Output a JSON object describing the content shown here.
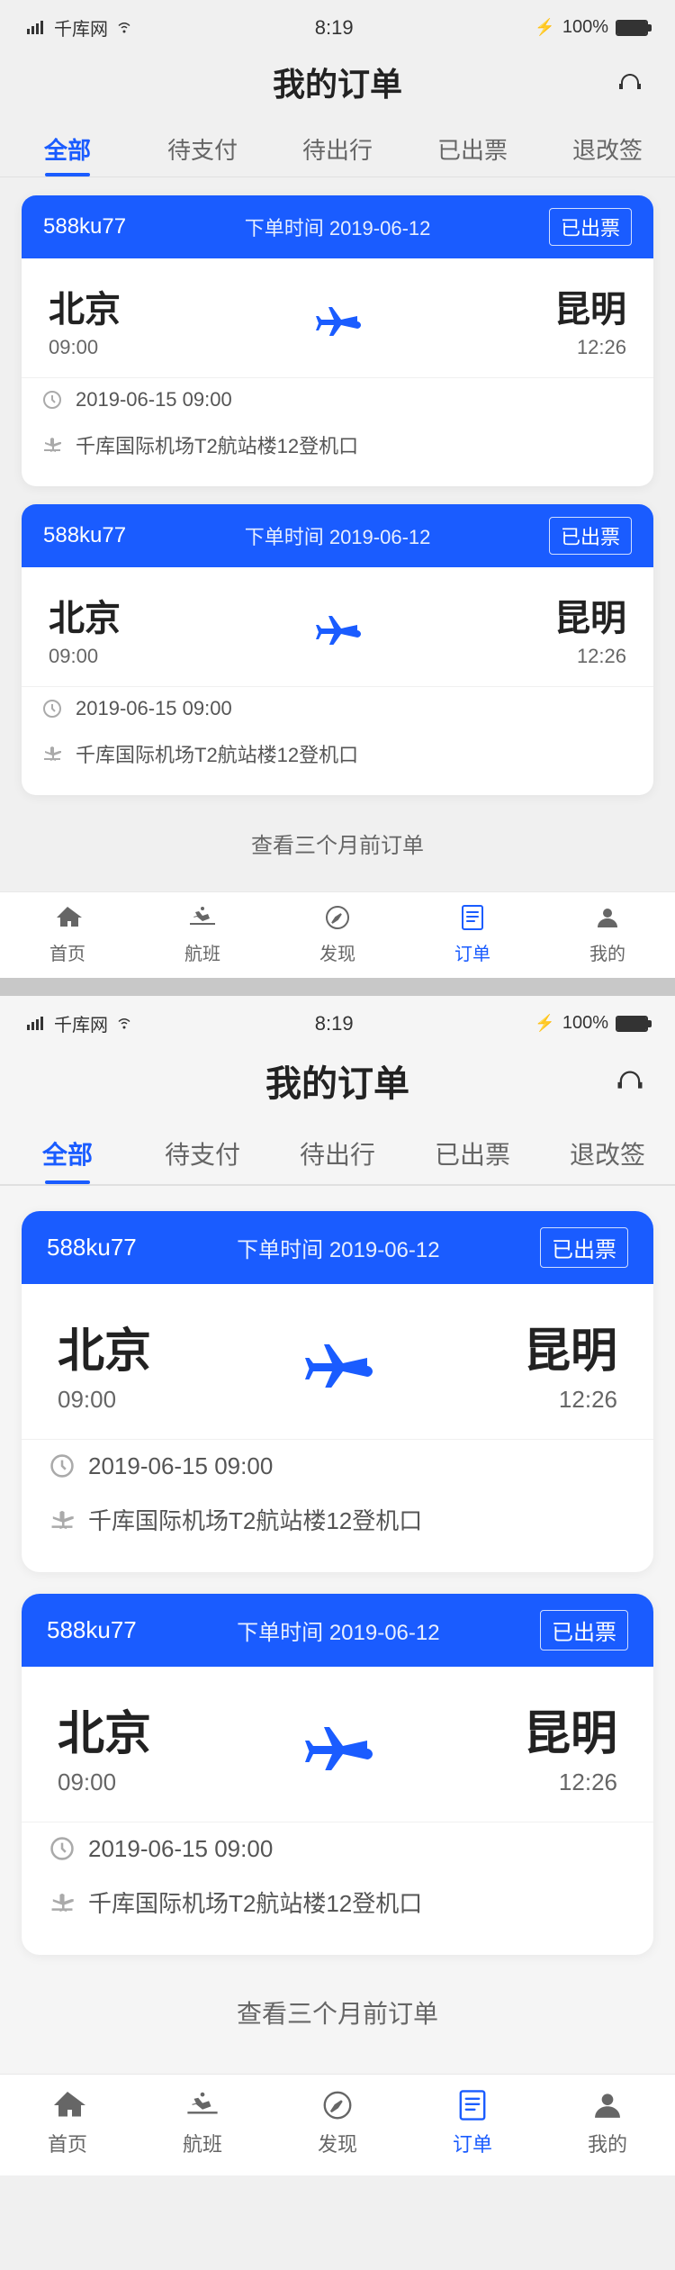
{
  "app": {
    "title": "我的订单"
  },
  "statusBar": {
    "signal": "千库网",
    "wifi": "WiFi",
    "time": "8:19",
    "bluetooth": "100%"
  },
  "tabs": [
    {
      "id": "all",
      "label": "全部",
      "active": true
    },
    {
      "id": "pending_pay",
      "label": "待支付",
      "active": false
    },
    {
      "id": "pending_depart",
      "label": "待出行",
      "active": false
    },
    {
      "id": "ticketed",
      "label": "已出票",
      "active": false
    },
    {
      "id": "refund",
      "label": "退改签",
      "active": false
    }
  ],
  "orders": [
    {
      "id": "588ku77",
      "order_time_label": "下单时间",
      "order_date": "2019-06-12",
      "status": "已出票",
      "from_city": "北京",
      "from_time": "09:00",
      "to_city": "昆明",
      "to_time": "12:26",
      "flight_date": "2019-06-15  09:00",
      "airport": "千库国际机场T2航站楼12登机口"
    },
    {
      "id": "588ku77",
      "order_time_label": "下单时间",
      "order_date": "2019-06-12",
      "status": "已出票",
      "from_city": "北京",
      "from_time": "09:00",
      "to_city": "昆明",
      "to_time": "12:26",
      "flight_date": "2019-06-15  09:00",
      "airport": "千库国际机场T2航站楼12登机口"
    }
  ],
  "see_more": "查看三个月前订单",
  "bottomNav": [
    {
      "id": "home",
      "label": "首页",
      "active": false
    },
    {
      "id": "flight",
      "label": "航班",
      "active": false
    },
    {
      "id": "discover",
      "label": "发现",
      "active": false
    },
    {
      "id": "orders",
      "label": "订单",
      "active": true
    },
    {
      "id": "mine",
      "label": "我的",
      "active": false
    }
  ]
}
